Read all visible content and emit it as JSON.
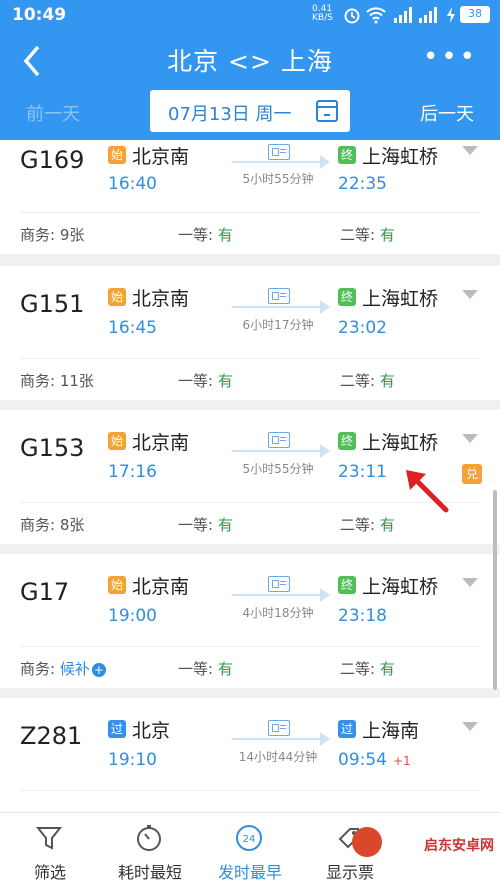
{
  "status_bar": {
    "time": "10:49",
    "net_speed": "0.41 KB/S",
    "battery": "38"
  },
  "header": {
    "back": "<",
    "title": "北京 <> 上海",
    "more": "•••"
  },
  "date_bar": {
    "prev": "前一天",
    "date": "07月13日 周一",
    "next": "后一天"
  },
  "trains": [
    {
      "number": "G169",
      "from_tag": "始",
      "from": "北京南",
      "depart": "16:40",
      "duration": "5小时55分钟",
      "to_tag": "终",
      "to": "上海虹桥",
      "arrive": "22:35",
      "plus": "",
      "seats": {
        "business_label": "商务:",
        "business": "9张",
        "first_label": "一等:",
        "first": "有",
        "second_label": "二等:",
        "second": "有"
      }
    },
    {
      "number": "G151",
      "from_tag": "始",
      "from": "北京南",
      "depart": "16:45",
      "duration": "6小时17分钟",
      "to_tag": "终",
      "to": "上海虹桥",
      "arrive": "23:02",
      "plus": "",
      "seats": {
        "business_label": "商务:",
        "business": "11张",
        "first_label": "一等:",
        "first": "有",
        "second_label": "二等:",
        "second": "有"
      }
    },
    {
      "number": "G153",
      "from_tag": "始",
      "from": "北京南",
      "depart": "17:16",
      "duration": "5小时55分钟",
      "to_tag": "终",
      "to": "上海虹桥",
      "arrive": "23:11",
      "plus": "",
      "badge": "兑",
      "seats": {
        "business_label": "商务:",
        "business": "8张",
        "first_label": "一等:",
        "first": "有",
        "second_label": "二等:",
        "second": "有"
      }
    },
    {
      "number": "G17",
      "from_tag": "始",
      "from": "北京南",
      "depart": "19:00",
      "duration": "4小时18分钟",
      "to_tag": "终",
      "to": "上海虹桥",
      "arrive": "23:18",
      "plus": "",
      "seats": {
        "business_label": "商务:",
        "business": "候补",
        "first_label": "一等:",
        "first": "有",
        "second_label": "二等:",
        "second": "有"
      }
    },
    {
      "number": "Z281",
      "from_tag": "过",
      "from": "北京",
      "depart": "19:10",
      "duration": "14小时44分钟",
      "to_tag": "过",
      "to": "上海南",
      "arrive": "09:54",
      "plus": "+1",
      "seats": {
        "business_label": "",
        "business": "",
        "first_label": "",
        "first": "",
        "second_label": "",
        "second": ""
      }
    }
  ],
  "bottom_tabs": [
    {
      "label": "筛选",
      "icon": "filter-icon"
    },
    {
      "label": "耗时最短",
      "icon": "stopwatch-icon"
    },
    {
      "label": "发时最早",
      "icon": "clock-24-icon"
    },
    {
      "label": "显示票",
      "icon": "ticket-tag-icon"
    }
  ],
  "watermark": "启东安卓网",
  "colors": {
    "header_blue": "#3396f0",
    "time_blue": "#2e8ee0",
    "avail_green": "#2e9a4a",
    "start_tag": "#f5a136",
    "end_tag": "#4fbf57",
    "pass_tag": "#3a8ee6",
    "annotation_red": "#e02020"
  }
}
